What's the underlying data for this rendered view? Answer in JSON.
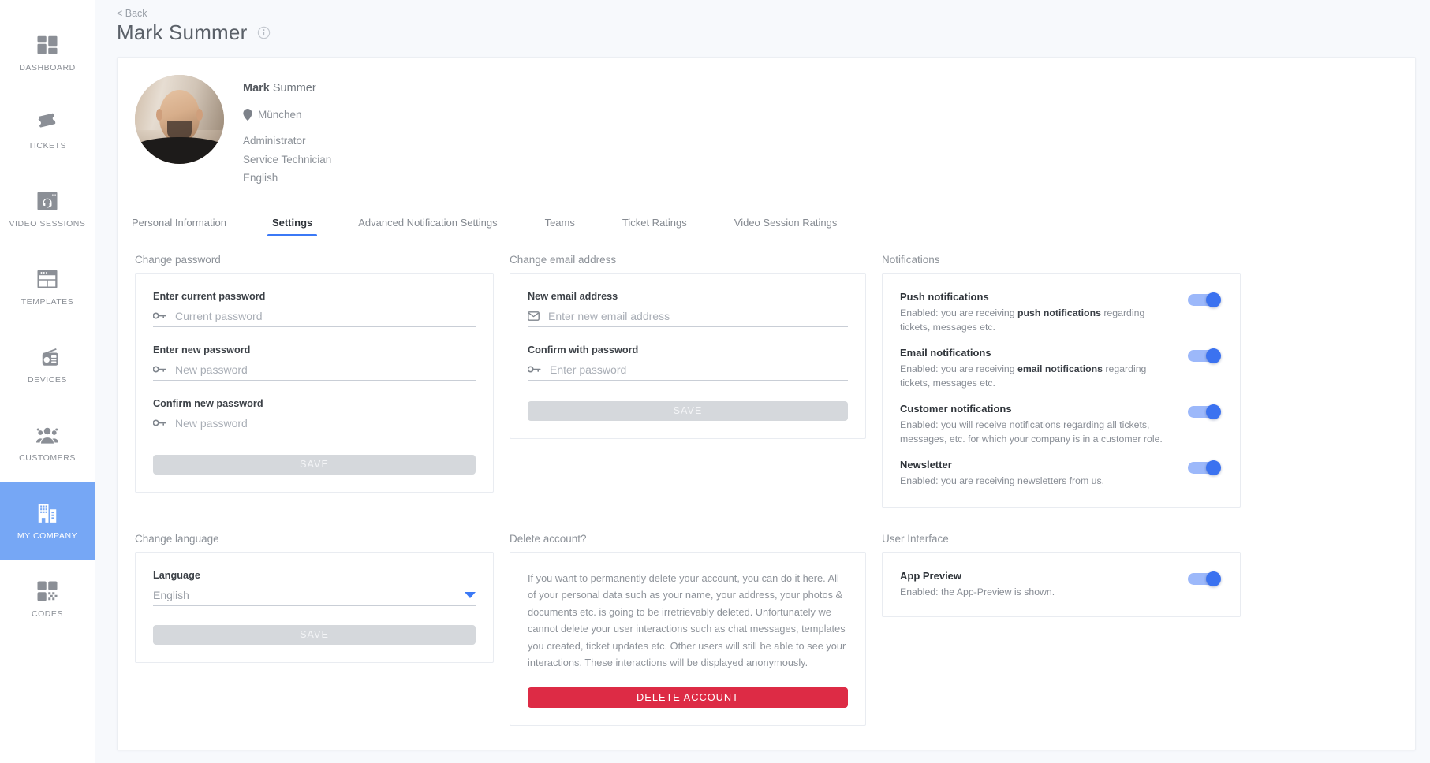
{
  "sidebar": {
    "items": [
      {
        "label": "DASHBOARD",
        "icon": "dashboard-icon",
        "active": false
      },
      {
        "label": "TICKETS",
        "icon": "ticket-icon",
        "active": false
      },
      {
        "label": "VIDEO SESSIONS",
        "icon": "video-session-icon",
        "active": false
      },
      {
        "label": "TEMPLATES",
        "icon": "template-icon",
        "active": false
      },
      {
        "label": "DEVICES",
        "icon": "device-radio-icon",
        "active": false
      },
      {
        "label": "CUSTOMERS",
        "icon": "customers-icon",
        "active": false
      },
      {
        "label": "MY COMPANY",
        "icon": "company-building-icon",
        "active": true
      },
      {
        "label": "CODES",
        "icon": "qr-code-icon",
        "active": false
      }
    ]
  },
  "header": {
    "back_label": "< Back",
    "title": "Mark Summer",
    "info_icon": "info-icon"
  },
  "profile": {
    "first_name": "Mark",
    "last_name": "Summer",
    "location": "München",
    "location_icon": "map-pin-icon",
    "roles": [
      "Administrator",
      "Service Technician",
      "English"
    ]
  },
  "tabs": [
    {
      "label": "Personal Information",
      "active": false
    },
    {
      "label": "Settings",
      "active": true
    },
    {
      "label": "Advanced Notification Settings",
      "active": false
    },
    {
      "label": "Teams",
      "active": false
    },
    {
      "label": "Ticket Ratings",
      "active": false
    },
    {
      "label": "Video Session Ratings",
      "active": false
    }
  ],
  "change_password": {
    "title": "Change password",
    "fields": [
      {
        "label": "Enter current password",
        "placeholder": "Current password",
        "icon": "key-icon",
        "value": ""
      },
      {
        "label": "Enter new password",
        "placeholder": "New password",
        "icon": "key-icon",
        "value": ""
      },
      {
        "label": "Confirm new password",
        "placeholder": "New password",
        "icon": "key-icon",
        "value": ""
      }
    ],
    "save_label": "SAVE"
  },
  "change_email": {
    "title": "Change email address",
    "fields": [
      {
        "label": "New email address",
        "placeholder": "Enter new email address",
        "icon": "envelope-icon",
        "value": ""
      },
      {
        "label": "Confirm with password",
        "placeholder": "Enter password",
        "icon": "key-icon",
        "value": ""
      }
    ],
    "save_label": "SAVE"
  },
  "notifications": {
    "title": "Notifications",
    "items": [
      {
        "name": "Push notifications",
        "desc_pre": "Enabled: you are receiving ",
        "desc_bold": "push notifications",
        "desc_post": " regarding tickets, messages etc.",
        "enabled": true
      },
      {
        "name": "Email notifications",
        "desc_pre": "Enabled: you are receiving ",
        "desc_bold": "email notifications",
        "desc_post": " regarding tickets, messages etc.",
        "enabled": true
      },
      {
        "name": "Customer notifications",
        "desc_pre": "Enabled: you will receive notifications regarding all tickets, messages, etc. for which your company is in a customer role.",
        "desc_bold": "",
        "desc_post": "",
        "enabled": true
      },
      {
        "name": "Newsletter",
        "desc_pre": "Enabled: you are receiving newsletters from us.",
        "desc_bold": "",
        "desc_post": "",
        "enabled": true
      }
    ]
  },
  "change_language": {
    "title": "Change language",
    "field_label": "Language",
    "selected": "English",
    "save_label": "SAVE",
    "caret_icon": "chevron-down-icon"
  },
  "delete_account": {
    "title": "Delete account?",
    "body": "If you want to permanently delete your account, you can do it here. All of your personal data such as your name, your address, your photos & documents etc. is going to be irretrievably deleted. Unfortunately we cannot delete your user interactions such as chat messages, templates you created, ticket updates etc. Other users will still be able to see your interactions. These interactions will be displayed anonymously.",
    "button_label": "DELETE ACCOUNT"
  },
  "user_interface": {
    "title": "User Interface",
    "items": [
      {
        "name": "App Preview",
        "desc_pre": "Enabled: the App-Preview is shown.",
        "desc_bold": "",
        "desc_post": "",
        "enabled": true
      }
    ]
  },
  "colors": {
    "accent_blue": "#3b79f6",
    "sidebar_active": "#76a7f5",
    "toggle_thumb": "#3b72f0",
    "toggle_track": "#9cb8fa",
    "danger_red": "#dd2b45",
    "page_bg": "#f7f9fc"
  }
}
